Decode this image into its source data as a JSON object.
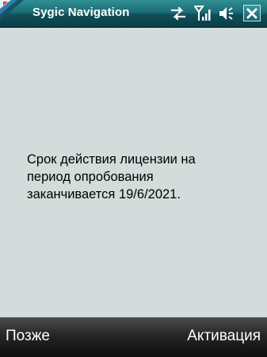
{
  "titlebar": {
    "app_title": "Sygic Navigation",
    "icons": [
      "windows-start-icon",
      "network-sync-icon",
      "signal-strength-icon",
      "volume-icon",
      "close-icon"
    ],
    "accent_color": "#1c6c74"
  },
  "dialog": {
    "message": "Срок действия лицензии на\nпериод опробования\nзаканчивается 19/6/2021."
  },
  "softkeys": {
    "left_label": "Позже",
    "right_label": "Активация"
  },
  "colors": {
    "background": "#d3dbdb",
    "softkey_bar": "#1a1a1a",
    "text": "#000000"
  }
}
